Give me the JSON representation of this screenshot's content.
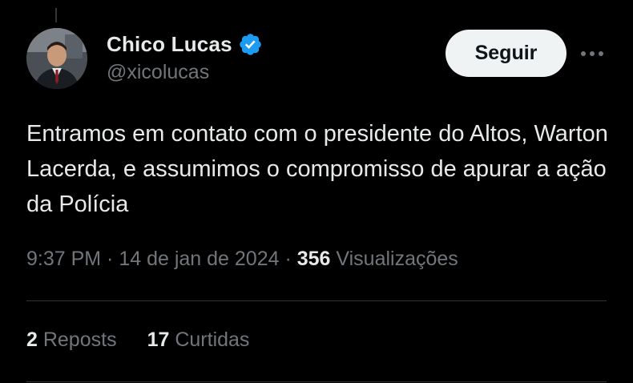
{
  "author": {
    "display_name": "Chico Lucas",
    "handle": "@xicolucas",
    "verified_icon": "verified-badge-icon",
    "verified_color": "#1d9bf0"
  },
  "actions": {
    "follow_label": "Seguir",
    "more_icon": "more-horizontal-icon"
  },
  "tweet": {
    "text": "Entramos em contato com o presidente do Altos, Warton Lacerda, e assumimos o compromisso de apurar a ação da Polícia"
  },
  "meta": {
    "time": "9:37 PM",
    "separator_1": " · ",
    "date": "14 de jan de 2024",
    "separator_2": " · ",
    "views_count": "356",
    "views_label": " Visualizações"
  },
  "stats": {
    "reposts_count": "2",
    "reposts_label": " Reposts",
    "likes_count": "17",
    "likes_label": " Curtidas"
  },
  "colors": {
    "background": "#000000",
    "primary_text": "#e7e9ea",
    "secondary_text": "#71767b",
    "divider": "#2f3336",
    "follow_bg": "#eff3f4"
  }
}
